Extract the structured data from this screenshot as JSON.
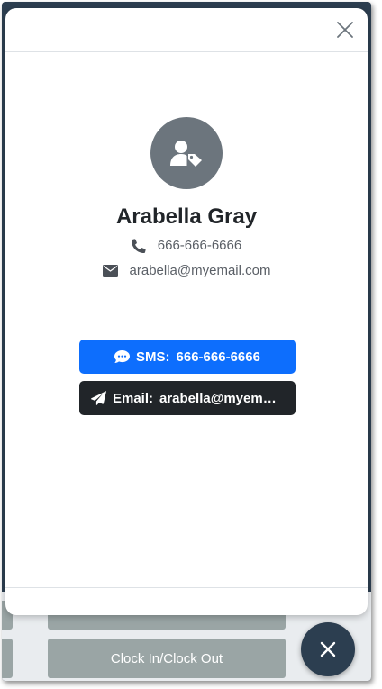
{
  "background": {
    "clock_button_label": "Clock In/Clock Out"
  },
  "contact": {
    "name": "Arabella Gray",
    "phone": "666-666-6666",
    "email": "arabella@myemail.com"
  },
  "actions": {
    "sms_label": "SMS:",
    "sms_value": "666-666-6666",
    "email_label": "Email:",
    "email_value": "arabella@myemail.com"
  },
  "icons": {
    "close": "close-icon",
    "avatar": "user-tag-icon",
    "phone": "phone-icon",
    "email": "envelope-icon",
    "sms": "comment-dots-icon",
    "send": "paper-plane-icon",
    "fab": "close-icon"
  },
  "colors": {
    "primary": "#0d6efd",
    "dark": "#212529",
    "avatar_bg": "#6c757d",
    "fab_bg": "#2c3e50"
  }
}
